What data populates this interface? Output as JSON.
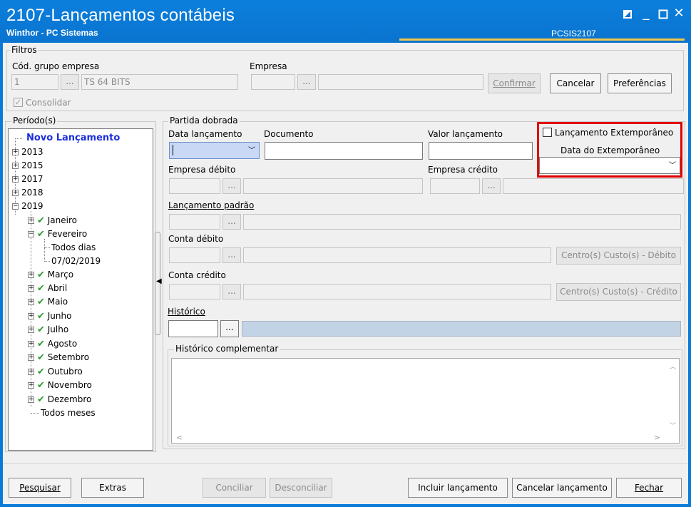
{
  "window": {
    "title": "2107-Lançamentos contábeis",
    "subtitle": "Winthor - PC Sistemas",
    "program_code": "PCSIS2107",
    "accent": "#0a7ad8",
    "highlight_color": "#e00000"
  },
  "filtros": {
    "group_label": "Filtros",
    "cod_grupo_label": "Cód. grupo empresa",
    "cod_grupo_value": "1",
    "grupo_name": "TS 64 BITS",
    "empresa_label": "Empresa",
    "empresa_value": "",
    "empresa_name": "",
    "ellipsis": "...",
    "consolidar_label": "Consolidar",
    "confirmar_label": "Confirmar",
    "cancelar_label": "Cancelar",
    "preferencias_label": "Preferências"
  },
  "periodo": {
    "group_label": "Período(s)",
    "root": "Novo Lançamento",
    "years": [
      "2013",
      "2015",
      "2017",
      "2018",
      "2019"
    ],
    "months": [
      "Janeiro",
      "Fevereiro",
      "Março",
      "Abril",
      "Maio",
      "Junho",
      "Julho",
      "Agosto",
      "Setembro",
      "Outubro",
      "Novembro",
      "Dezembro"
    ],
    "fevereiro_children": [
      "Todos dias",
      "07/02/2019"
    ],
    "todos_meses": "Todos meses"
  },
  "partida": {
    "group_label": "Partida dobrada",
    "data_lancamento_label": "Data lançamento",
    "documento_label": "Documento",
    "valor_label": "Valor lançamento",
    "extemporaneo_label": "Lançamento Extemporâneo",
    "data_extemporaneo_label": "Data do Extemporâneo",
    "empresa_debito_label": "Empresa débito",
    "empresa_credito_label": "Empresa crédito",
    "lancamento_padrao_label": "Lançamento padrão",
    "conta_debito_label": "Conta débito",
    "conta_credito_label": "Conta crédito",
    "centro_debito_label": "Centro(s) Custo(s) - Débito",
    "centro_credito_label": "Centro(s) Custo(s) - Crédito",
    "historico_label": "Histórico",
    "historico_comp_label": "Histórico complementar"
  },
  "footer": {
    "pesquisar": "Pesquisar",
    "extras": "Extras",
    "conciliar": "Conciliar",
    "desconciliar": "Desconciliar",
    "incluir": "Incluir lançamento",
    "cancelar_lancamento": "Cancelar lançamento",
    "fechar": "Fechar"
  }
}
